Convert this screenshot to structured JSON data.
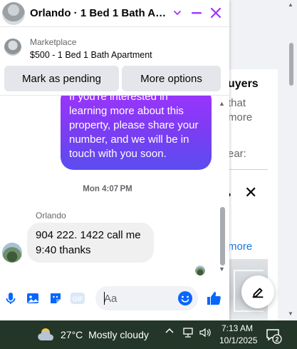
{
  "background_page": {
    "heading_fragment": "uyers",
    "text_fragment_1": "that",
    "text_fragment_2": "more",
    "text_fragment_3": "ear:",
    "dots": "•",
    "close_glyph": "✕",
    "link_fragment": "more"
  },
  "chat": {
    "title": "Orlando · 1 Bed 1 Bath Apa...",
    "listing": {
      "category": "Marketplace",
      "summary": "$500 - 1 Bed 1 Bath Apartment"
    },
    "actions": {
      "mark_pending": "Mark as pending",
      "more_options": "More options"
    },
    "messages": {
      "outgoing": "If you're interested in learning more about this property, please share your number, and we will be in touch with you soon.",
      "timestamp": "Mon 4:07 PM",
      "sender": "Orlando",
      "incoming": "904 222. 1422 call me 9:40 thanks"
    },
    "composer": {
      "placeholder": "Aa",
      "value": ""
    }
  },
  "taskbar": {
    "temperature": "27°C",
    "condition": "Mostly cloudy",
    "time": "7:13 AM",
    "date": "10/1/2025",
    "notification_count": "2"
  },
  "colors": {
    "accent": "#a033ff",
    "messenger_blue": "#0866ff",
    "taskbar": "#233627"
  },
  "icons": [
    "chevron-down-icon",
    "minimize-icon",
    "close-icon",
    "microphone-icon",
    "photo-icon",
    "sticker-icon",
    "gif-icon",
    "emoji-icon",
    "like-icon",
    "compose-icon",
    "weather-icon",
    "network-icon",
    "volume-icon",
    "notification-icon"
  ]
}
